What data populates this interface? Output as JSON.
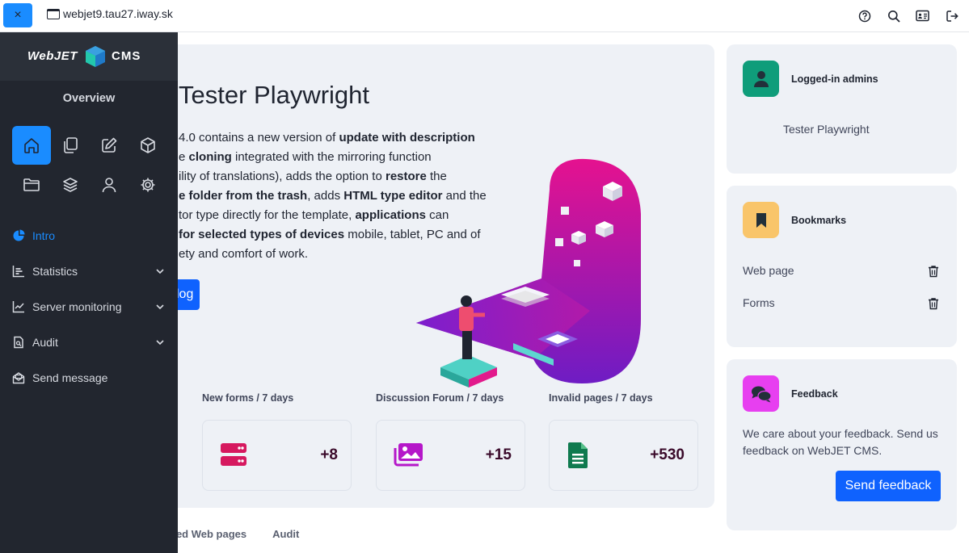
{
  "topbar": {
    "close_glyph": "×",
    "url": "webjet9.tau27.iway.sk",
    "icons": [
      "help-icon",
      "search-icon",
      "contact-card-icon",
      "logout-icon"
    ]
  },
  "sidebar": {
    "logo_text": "WebJET CMS",
    "overview": "Overview",
    "apps": [
      "home-icon",
      "pages-icon",
      "edit-icon",
      "box-icon",
      "folder-icon",
      "layers-icon",
      "user-icon",
      "gear-icon"
    ],
    "menu": [
      {
        "label": "Intro",
        "icon": "pie-chart-icon",
        "active": true
      },
      {
        "label": "Statistics",
        "icon": "bar-chart-icon"
      },
      {
        "label": "Server monitoring",
        "icon": "line-chart-icon"
      },
      {
        "label": "Audit",
        "icon": "document-search-icon"
      },
      {
        "label": "Send message",
        "icon": "envelope-icon"
      }
    ]
  },
  "hero": {
    "title": "Tester Playwright",
    "lines": [
      [
        {
          "t": "4.0 contains a new version of "
        },
        {
          "t": "update with description",
          "b": true
        }
      ],
      [
        {
          "t": "e "
        },
        {
          "t": "cloning",
          "b": true
        },
        {
          "t": " integrated with the mirroring function"
        }
      ],
      [
        {
          "t": "ility of translations), adds the option to "
        },
        {
          "t": "restore",
          "b": true
        },
        {
          "t": " the"
        }
      ],
      [
        {
          "t": "e folder from the trash",
          "b": true
        },
        {
          "t": ", adds "
        },
        {
          "t": "HTML type editor",
          "b": true
        },
        {
          "t": " and the"
        }
      ],
      [
        {
          "t": "tor type directly for the template, "
        },
        {
          "t": "applications",
          "b": true
        },
        {
          "t": " can"
        }
      ],
      [
        {
          "t": "for selected types of devices",
          "b": true
        },
        {
          "t": " mobile, tablet, PC and of"
        }
      ],
      [
        {
          "t": "ety and comfort of work."
        }
      ]
    ],
    "button": "log"
  },
  "stats": [
    {
      "label": "New forms / 7 days",
      "value": "+8",
      "icon": "server-icon",
      "color": "#d6195f"
    },
    {
      "label": "Discussion Forum / 7 days",
      "value": "+15",
      "icon": "images-icon",
      "color": "#b517c9"
    },
    {
      "label": "Invalid pages / 7 days",
      "value": "+530",
      "icon": "spreadsheet-icon",
      "color": "#0f7a4f"
    }
  ],
  "bottom_tabs": [
    "ged Web pages",
    "Audit"
  ],
  "logged_in": {
    "title": "Logged-in admins",
    "user": "Tester Playwright",
    "color": "#0f9d7a"
  },
  "bookmarks": {
    "title": "Bookmarks",
    "items": [
      "Web page",
      "Forms"
    ],
    "color": "#f9c56a"
  },
  "feedback": {
    "title": "Feedback",
    "text_line1": "We care about your feedback. Send us",
    "text_line2": "feedback on WebJET CMS.",
    "button": "Send feedback",
    "color": "#e73ff0"
  }
}
